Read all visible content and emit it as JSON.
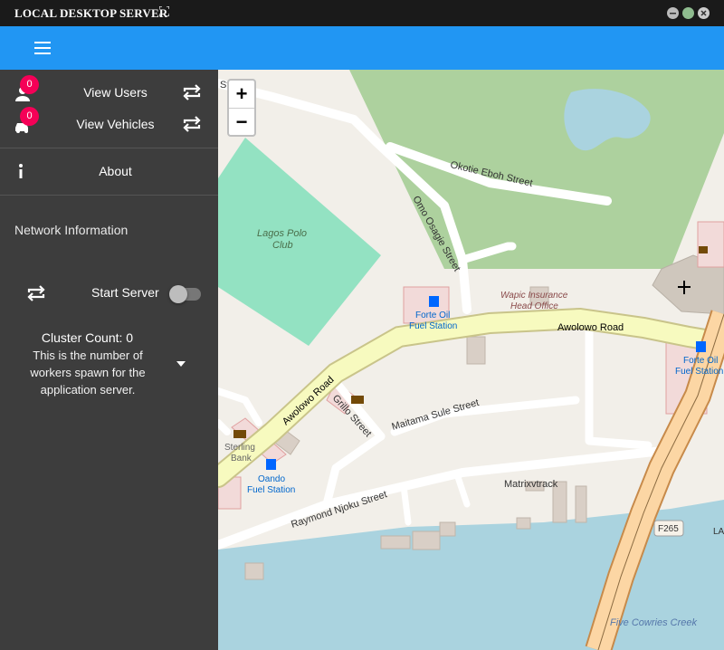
{
  "window": {
    "title": "LOCAL DESKTOP SERVER",
    "controls": [
      "minimize-icon",
      "maximize-icon",
      "close-icon"
    ]
  },
  "appbar": {
    "menu_icon": "menu-icon",
    "color": "#2196f3"
  },
  "sidebar": {
    "items": [
      {
        "label": "View Users",
        "badge": "0",
        "icon": "user-icon",
        "action_icon": "repeat-icon"
      },
      {
        "label": "View Vehicles",
        "badge": "0",
        "icon": "car-icon",
        "action_icon": "repeat-icon"
      },
      {
        "label": "About",
        "icon": "info-icon"
      }
    ],
    "section_title": "Network Information",
    "server": {
      "label": "Start Server",
      "icon": "repeat-icon",
      "toggle_on": false
    },
    "cluster": {
      "count_label": "Cluster Count: 0",
      "description": "This is the number of workers spawn for the application server.",
      "dropdown_icon": "caret-down-icon"
    }
  },
  "map": {
    "zoom_in": "+",
    "zoom_out": "−",
    "labels": {
      "okotie": "Okotie Eboh Street",
      "omo": "Omo Osagie Street",
      "polo1": "Lagos Polo",
      "polo2": "Club",
      "wapic1": "Wapic Insurance",
      "wapic2": "Head Office",
      "forte1a": "Forte Oil",
      "forte1b": "Fuel Station",
      "awolowo1": "Awolowo Road",
      "awolowo2": "Awolowo Road",
      "forte2a": "Forte Oil",
      "forte2b": "Fuel Station",
      "grillo": "Grillo Street",
      "maitama": "Maitama Sule Street",
      "sterling1": "Sterling",
      "sterling2": "Bank",
      "oando1": "Oando",
      "oando2": "Fuel Station",
      "matrix": "Matrixvtrack",
      "raymond": "Raymond Njoku Street",
      "f265": "F265",
      "la": "LA",
      "five": "Five Cowries Creek",
      "st": "St"
    }
  }
}
